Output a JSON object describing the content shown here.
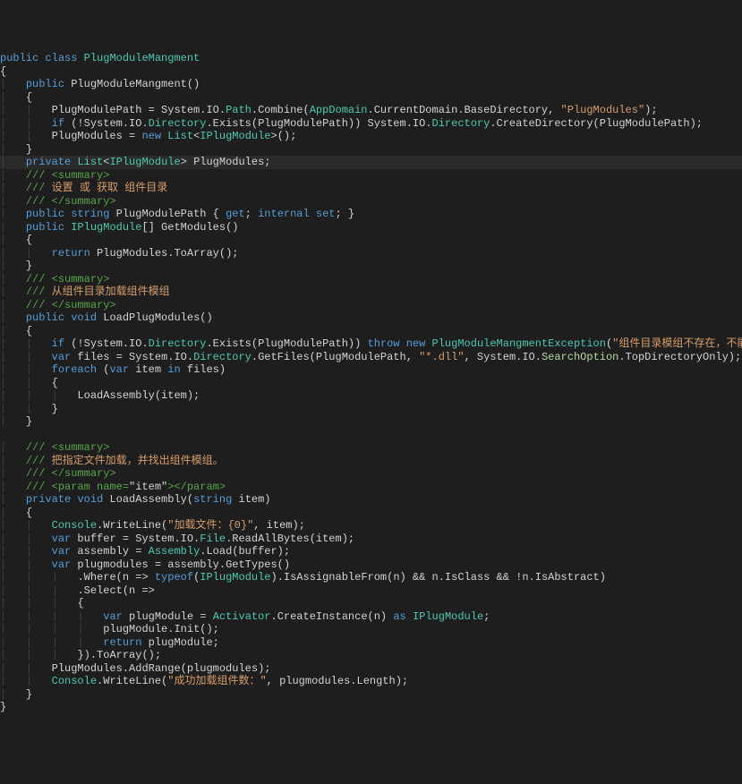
{
  "lines": [
    {
      "indent": 0,
      "segs": [
        {
          "t": "public",
          "c": "kw"
        },
        {
          "t": " ",
          "c": "plain"
        },
        {
          "t": "class",
          "c": "kw"
        },
        {
          "t": " ",
          "c": "plain"
        },
        {
          "t": "PlugModuleMangment",
          "c": "type"
        }
      ]
    },
    {
      "indent": 0,
      "segs": [
        {
          "t": "{",
          "c": "plain"
        }
      ]
    },
    {
      "indent": 1,
      "segs": [
        {
          "t": "public",
          "c": "kw"
        },
        {
          "t": " PlugModuleMangment()",
          "c": "plain"
        }
      ]
    },
    {
      "indent": 1,
      "segs": [
        {
          "t": "{",
          "c": "plain"
        }
      ]
    },
    {
      "indent": 2,
      "segs": [
        {
          "t": "PlugModulePath = System.IO.",
          "c": "plain"
        },
        {
          "t": "Path",
          "c": "type"
        },
        {
          "t": ".Combine(",
          "c": "plain"
        },
        {
          "t": "AppDomain",
          "c": "type"
        },
        {
          "t": ".CurrentDomain.BaseDirectory, ",
          "c": "plain"
        },
        {
          "t": "\"PlugModules\"",
          "c": "str"
        },
        {
          "t": ");",
          "c": "plain"
        }
      ]
    },
    {
      "indent": 2,
      "segs": [
        {
          "t": "if",
          "c": "kw"
        },
        {
          "t": " (!System.IO.",
          "c": "plain"
        },
        {
          "t": "Directory",
          "c": "type"
        },
        {
          "t": ".Exists(PlugModulePath)) System.IO.",
          "c": "plain"
        },
        {
          "t": "Directory",
          "c": "type"
        },
        {
          "t": ".CreateDirectory(PlugModulePath);",
          "c": "plain"
        }
      ]
    },
    {
      "indent": 2,
      "segs": [
        {
          "t": "PlugModules = ",
          "c": "plain"
        },
        {
          "t": "new",
          "c": "kw"
        },
        {
          "t": " ",
          "c": "plain"
        },
        {
          "t": "List",
          "c": "type"
        },
        {
          "t": "<",
          "c": "plain"
        },
        {
          "t": "IPlugModule",
          "c": "type"
        },
        {
          "t": ">();",
          "c": "plain"
        }
      ]
    },
    {
      "indent": 1,
      "segs": [
        {
          "t": "}",
          "c": "plain"
        }
      ]
    },
    {
      "indent": 1,
      "segs": [
        {
          "t": "private",
          "c": "kw"
        },
        {
          "t": " ",
          "c": "plain"
        },
        {
          "t": "List",
          "c": "type"
        },
        {
          "t": "<",
          "c": "plain"
        },
        {
          "t": "IPlugModule",
          "c": "type"
        },
        {
          "t": "> PlugModules;",
          "c": "plain"
        }
      ],
      "hl": true
    },
    {
      "indent": 1,
      "segs": [
        {
          "t": "/// <summary>",
          "c": "cmt"
        }
      ]
    },
    {
      "indent": 1,
      "segs": [
        {
          "t": "/// ",
          "c": "cmt"
        },
        {
          "t": "设置 或 获取 组件目录",
          "c": "str"
        }
      ]
    },
    {
      "indent": 1,
      "segs": [
        {
          "t": "/// </summary>",
          "c": "cmt"
        }
      ]
    },
    {
      "indent": 1,
      "segs": [
        {
          "t": "public",
          "c": "kw"
        },
        {
          "t": " ",
          "c": "plain"
        },
        {
          "t": "string",
          "c": "kw"
        },
        {
          "t": " PlugModulePath { ",
          "c": "plain"
        },
        {
          "t": "get",
          "c": "kw2"
        },
        {
          "t": "; ",
          "c": "plain"
        },
        {
          "t": "internal",
          "c": "kw"
        },
        {
          "t": " ",
          "c": "plain"
        },
        {
          "t": "set",
          "c": "kw2"
        },
        {
          "t": "; }",
          "c": "plain"
        }
      ]
    },
    {
      "indent": 1,
      "segs": [
        {
          "t": "public",
          "c": "kw"
        },
        {
          "t": " ",
          "c": "plain"
        },
        {
          "t": "IPlugModule",
          "c": "type"
        },
        {
          "t": "[] GetModules()",
          "c": "plain"
        }
      ]
    },
    {
      "indent": 1,
      "segs": [
        {
          "t": "{",
          "c": "plain"
        }
      ]
    },
    {
      "indent": 2,
      "segs": [
        {
          "t": "return",
          "c": "kw"
        },
        {
          "t": " PlugModules.ToArray();",
          "c": "plain"
        }
      ]
    },
    {
      "indent": 1,
      "segs": [
        {
          "t": "}",
          "c": "plain"
        }
      ]
    },
    {
      "indent": 1,
      "segs": [
        {
          "t": "/// <summary>",
          "c": "cmt"
        }
      ]
    },
    {
      "indent": 1,
      "segs": [
        {
          "t": "/// ",
          "c": "cmt"
        },
        {
          "t": "从组件目录加载组件模组",
          "c": "str"
        }
      ]
    },
    {
      "indent": 1,
      "segs": [
        {
          "t": "/// </summary>",
          "c": "cmt"
        }
      ]
    },
    {
      "indent": 1,
      "segs": [
        {
          "t": "public",
          "c": "kw"
        },
        {
          "t": " ",
          "c": "plain"
        },
        {
          "t": "void",
          "c": "kw"
        },
        {
          "t": " LoadPlugModules()",
          "c": "plain"
        }
      ]
    },
    {
      "indent": 1,
      "segs": [
        {
          "t": "{",
          "c": "plain"
        }
      ]
    },
    {
      "indent": 2,
      "segs": [
        {
          "t": "if",
          "c": "kw"
        },
        {
          "t": " (!System.IO.",
          "c": "plain"
        },
        {
          "t": "Directory",
          "c": "type"
        },
        {
          "t": ".Exists(PlugModulePath)) ",
          "c": "plain"
        },
        {
          "t": "throw",
          "c": "kw"
        },
        {
          "t": " ",
          "c": "plain"
        },
        {
          "t": "new",
          "c": "kw"
        },
        {
          "t": " ",
          "c": "plain"
        },
        {
          "t": "PlugModuleMangmentException",
          "c": "ex"
        },
        {
          "t": "(",
          "c": "plain"
        },
        {
          "t": "\"组件目录模组不存在，不能加载组件模组\"",
          "c": "str"
        },
        {
          "t": ");",
          "c": "plain"
        }
      ]
    },
    {
      "indent": 2,
      "segs": [
        {
          "t": "var",
          "c": "kw"
        },
        {
          "t": " files = System.IO.",
          "c": "plain"
        },
        {
          "t": "Directory",
          "c": "type"
        },
        {
          "t": ".GetFiles(PlugModulePath, ",
          "c": "plain"
        },
        {
          "t": "\"*.dll\"",
          "c": "str"
        },
        {
          "t": ", System.IO.",
          "c": "plain"
        },
        {
          "t": "SearchOption",
          "c": "enum"
        },
        {
          "t": ".TopDirectoryOnly);",
          "c": "plain"
        }
      ]
    },
    {
      "indent": 2,
      "segs": [
        {
          "t": "foreach",
          "c": "kw"
        },
        {
          "t": " (",
          "c": "plain"
        },
        {
          "t": "var",
          "c": "kw"
        },
        {
          "t": " item ",
          "c": "plain"
        },
        {
          "t": "in",
          "c": "kw"
        },
        {
          "t": " files)",
          "c": "plain"
        }
      ]
    },
    {
      "indent": 2,
      "segs": [
        {
          "t": "{",
          "c": "plain"
        }
      ]
    },
    {
      "indent": 3,
      "segs": [
        {
          "t": "LoadAssembly(item);",
          "c": "plain"
        }
      ]
    },
    {
      "indent": 2,
      "segs": [
        {
          "t": "}",
          "c": "plain"
        }
      ]
    },
    {
      "indent": 1,
      "segs": [
        {
          "t": "}",
          "c": "plain"
        }
      ]
    },
    {
      "indent": 0,
      "segs": [
        {
          "t": "",
          "c": "plain"
        }
      ]
    },
    {
      "indent": 1,
      "segs": [
        {
          "t": "/// <summary>",
          "c": "cmt"
        }
      ]
    },
    {
      "indent": 1,
      "segs": [
        {
          "t": "/// ",
          "c": "cmt"
        },
        {
          "t": "把指定文件加载，并找出组件模组。",
          "c": "str"
        }
      ]
    },
    {
      "indent": 1,
      "segs": [
        {
          "t": "/// </summary>",
          "c": "cmt"
        }
      ]
    },
    {
      "indent": 1,
      "segs": [
        {
          "t": "/// <param name=",
          "c": "cmt"
        },
        {
          "t": "\"item\"",
          "c": "plain"
        },
        {
          "t": "></param>",
          "c": "cmt"
        }
      ]
    },
    {
      "indent": 1,
      "segs": [
        {
          "t": "private",
          "c": "kw"
        },
        {
          "t": " ",
          "c": "plain"
        },
        {
          "t": "void",
          "c": "kw"
        },
        {
          "t": " LoadAssembly(",
          "c": "plain"
        },
        {
          "t": "string",
          "c": "kw"
        },
        {
          "t": " item)",
          "c": "plain"
        }
      ]
    },
    {
      "indent": 1,
      "segs": [
        {
          "t": "{",
          "c": "plain"
        }
      ]
    },
    {
      "indent": 2,
      "segs": [
        {
          "t": "Console",
          "c": "type"
        },
        {
          "t": ".WriteLine(",
          "c": "plain"
        },
        {
          "t": "\"加载文件：{0}\"",
          "c": "str"
        },
        {
          "t": ", item);",
          "c": "plain"
        }
      ]
    },
    {
      "indent": 2,
      "segs": [
        {
          "t": "var",
          "c": "kw"
        },
        {
          "t": " buffer = System.IO.",
          "c": "plain"
        },
        {
          "t": "File",
          "c": "type"
        },
        {
          "t": ".ReadAllBytes(item);",
          "c": "plain"
        }
      ]
    },
    {
      "indent": 2,
      "segs": [
        {
          "t": "var",
          "c": "kw"
        },
        {
          "t": " assembly = ",
          "c": "plain"
        },
        {
          "t": "Assembly",
          "c": "type"
        },
        {
          "t": ".Load(buffer);",
          "c": "plain"
        }
      ]
    },
    {
      "indent": 2,
      "segs": [
        {
          "t": "var",
          "c": "kw"
        },
        {
          "t": " plugmodules = assembly.GetTypes()",
          "c": "plain"
        }
      ]
    },
    {
      "indent": 3,
      "segs": [
        {
          "t": ".Where(n => ",
          "c": "plain"
        },
        {
          "t": "typeof",
          "c": "kw"
        },
        {
          "t": "(",
          "c": "plain"
        },
        {
          "t": "IPlugModule",
          "c": "type"
        },
        {
          "t": ").IsAssignableFrom(n) && n.IsClass && !n.IsAbstract)",
          "c": "plain"
        }
      ]
    },
    {
      "indent": 3,
      "segs": [
        {
          "t": ".Select(n =>",
          "c": "plain"
        }
      ]
    },
    {
      "indent": 3,
      "segs": [
        {
          "t": "{",
          "c": "plain"
        }
      ]
    },
    {
      "indent": 4,
      "segs": [
        {
          "t": "var",
          "c": "kw"
        },
        {
          "t": " plugModule = ",
          "c": "plain"
        },
        {
          "t": "Activator",
          "c": "type"
        },
        {
          "t": ".CreateInstance(n) ",
          "c": "plain"
        },
        {
          "t": "as",
          "c": "kw"
        },
        {
          "t": " ",
          "c": "plain"
        },
        {
          "t": "IPlugModule",
          "c": "type"
        },
        {
          "t": ";",
          "c": "plain"
        }
      ]
    },
    {
      "indent": 4,
      "segs": [
        {
          "t": "plugModule.Init();",
          "c": "plain"
        }
      ]
    },
    {
      "indent": 4,
      "segs": [
        {
          "t": "return",
          "c": "kw"
        },
        {
          "t": " plugModule;",
          "c": "plain"
        }
      ]
    },
    {
      "indent": 3,
      "segs": [
        {
          "t": "}).ToArray();",
          "c": "plain"
        }
      ]
    },
    {
      "indent": 2,
      "segs": [
        {
          "t": "PlugModules.AddRange(plugmodules);",
          "c": "plain"
        }
      ]
    },
    {
      "indent": 2,
      "segs": [
        {
          "t": "Console",
          "c": "type"
        },
        {
          "t": ".WriteLine(",
          "c": "plain"
        },
        {
          "t": "\"成功加载组件数：\"",
          "c": "str"
        },
        {
          "t": ", plugmodules.Length);",
          "c": "plain"
        }
      ]
    },
    {
      "indent": 1,
      "segs": [
        {
          "t": "}",
          "c": "plain"
        }
      ]
    },
    {
      "indent": 0,
      "segs": [
        {
          "t": "}",
          "c": "plain"
        }
      ]
    }
  ]
}
